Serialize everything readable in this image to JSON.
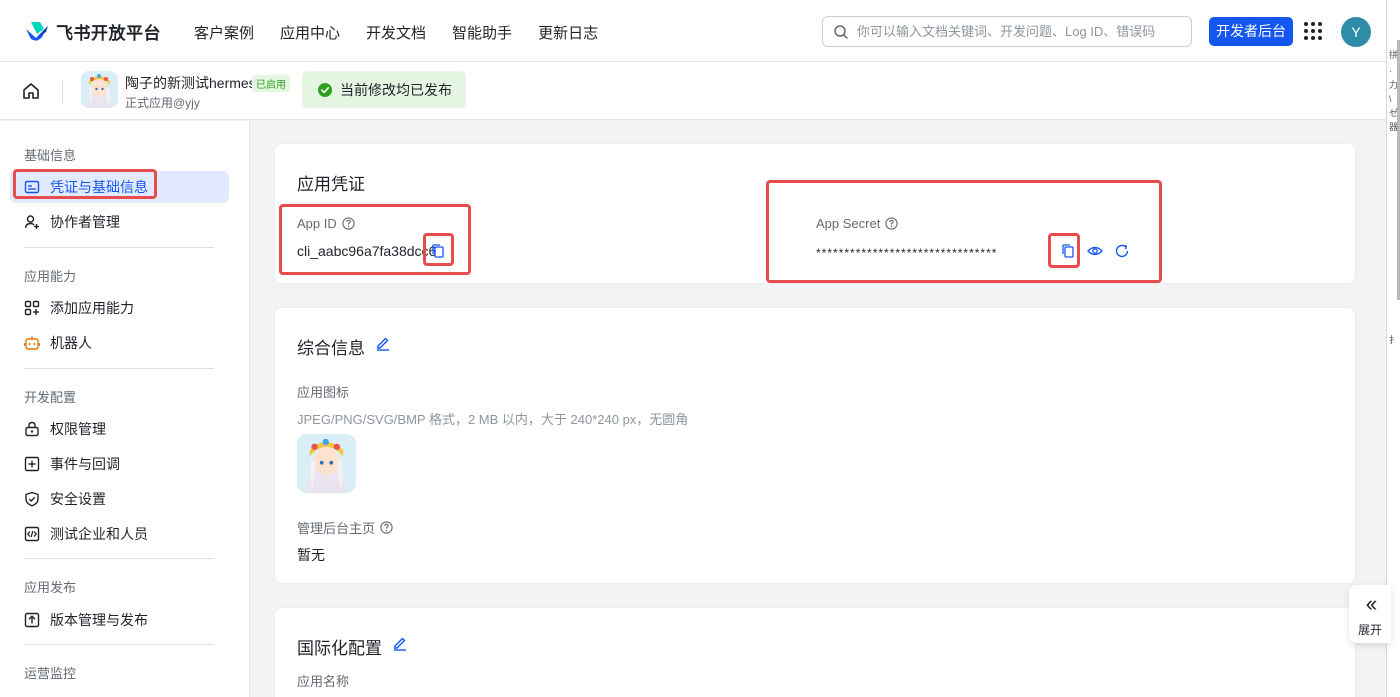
{
  "topnav": {
    "brand": "飞书开放平台",
    "links": [
      "客户案例",
      "应用中心",
      "开发文档",
      "智能助手",
      "更新日志"
    ],
    "search_placeholder": "你可以输入文档关键词、开发问题、Log ID、错误码",
    "dev_console": "开发者后台",
    "user_initial": "Y",
    "avatar_color": "#2f8ca9",
    "accent": "#1456f0"
  },
  "subbar": {
    "app_name": "陶子的新测试hermes",
    "app_status": "已启用",
    "app_owner": "正式应用@yjy",
    "publish_status": "当前修改均已发布"
  },
  "sidebar": {
    "groups": {
      "basic": "基础信息",
      "capability": "应用能力",
      "dev_config": "开发配置",
      "release": "应用发布",
      "ops": "运营监控"
    },
    "items": {
      "credentials": "凭证与基础信息",
      "collaborators": "协作者管理",
      "add_capability": "添加应用能力",
      "bot": "机器人",
      "permissions": "权限管理",
      "events": "事件与回调",
      "security": "安全设置",
      "test_org": "测试企业和人员",
      "versions": "版本管理与发布"
    }
  },
  "credentials": {
    "title": "应用凭证",
    "app_id_label": "App ID",
    "app_id_value": "cli_aabc96a7fa38dcc6",
    "app_secret_label": "App Secret",
    "app_secret_value": "********************************"
  },
  "general": {
    "title": "综合信息",
    "icon_label": "应用图标",
    "icon_hint": "JPEG/PNG/SVG/BMP 格式，2 MB 以内，大于 240*240 px，无圆角",
    "admin_home_label": "管理后台主页",
    "admin_home_value": "暂无"
  },
  "i18n": {
    "title": "国际化配置",
    "app_name_label": "应用名称"
  },
  "expand": {
    "label": "展开"
  },
  "edge_glyphs": [
    "拼",
    "·",
    "力",
    "\\",
    "ゼ",
    "器",
    "扌"
  ]
}
